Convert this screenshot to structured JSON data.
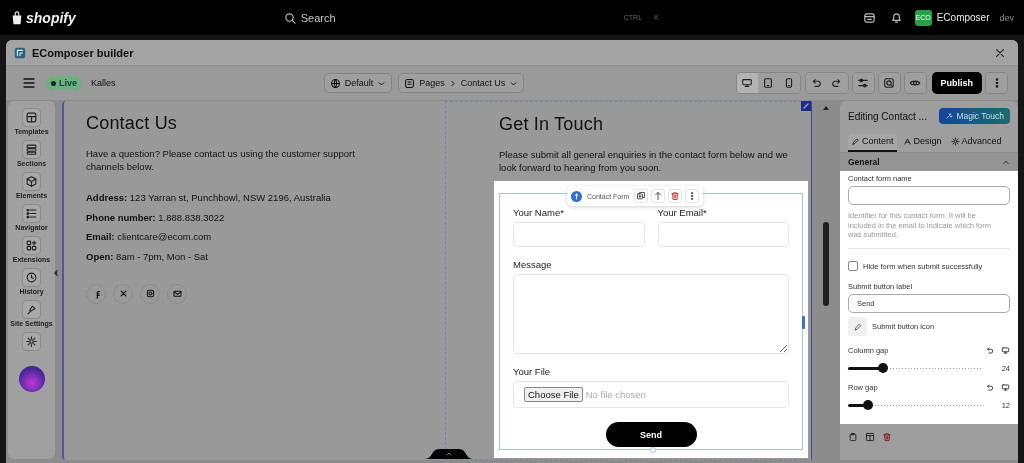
{
  "topbar": {
    "brand": "shopify",
    "search": {
      "placeholder": "Search"
    },
    "shortcut": [
      "CTRL",
      "K"
    ],
    "store": {
      "badge": "ECO",
      "name": "EComposer",
      "role": "dev"
    }
  },
  "window": {
    "title": "EComposer builder"
  },
  "toolbar": {
    "status": "Live",
    "store": "Kalles",
    "theme": "Default",
    "breadcrumb": [
      "Pages",
      "Contact Us"
    ],
    "devices": [
      {
        "kind": "desktop",
        "selected": true
      },
      {
        "kind": "tablet",
        "selected": false
      },
      {
        "kind": "mobile",
        "selected": false
      }
    ],
    "publish": "Publish"
  },
  "sidebar": {
    "items": [
      {
        "kind": "templates",
        "label": "Templates"
      },
      {
        "kind": "sections",
        "label": "Sections"
      },
      {
        "kind": "elements",
        "label": "Elements"
      },
      {
        "kind": "navigator",
        "label": "Navigator"
      },
      {
        "kind": "extensions",
        "label": "Extensions"
      },
      {
        "kind": "history",
        "label": "History"
      },
      {
        "kind": "site_settings",
        "label": "Site Settings"
      },
      {
        "kind": "settings"
      }
    ]
  },
  "page": {
    "left": {
      "heading": "Contact Us",
      "intro": "Have a question? Please contact us using the customer support channels below.",
      "details": [
        "**Address:** 123 Yarran st, Punchbowl, NSW 2196, Australia",
        "**Phone number:** 1.888.838.3022",
        "**Email:** clientcare@ecom.com",
        "**Open:** 8am - 7pm, Mon - Sat"
      ],
      "social": [
        {
          "kind": "facebook"
        },
        {
          "kind": "x"
        },
        {
          "kind": "instagram"
        },
        {
          "kind": "email"
        }
      ]
    },
    "right": {
      "heading": "Get In Touch",
      "intro": "Please submit all general enquiries in the contact form below and we look forward to hearing from you soon.",
      "form": {
        "toolbar_label": "Contact Form",
        "fields": [
          {
            "kind": "text",
            "label": "Your Name*"
          },
          {
            "kind": "text",
            "label": "Your Email*"
          },
          {
            "kind": "textarea",
            "label": "Message"
          },
          {
            "kind": "file",
            "label": "Your File",
            "button": "Choose File",
            "status": "No file chosen"
          }
        ],
        "submit": "Send"
      }
    }
  },
  "panel": {
    "title": "Editing Contact ...",
    "magic": "Magic Touch",
    "tabs": [
      {
        "label": "Content",
        "selected": true
      },
      {
        "label": "Design",
        "selected": false
      },
      {
        "label": "Advanced",
        "selected": false
      }
    ],
    "section": {
      "title": "General",
      "expanded": true
    },
    "settings": [
      {
        "kind": "text",
        "label": "Contact form name",
        "hint": "Identifier for this contact form. It will be included in the email to indicate which form was submitted."
      },
      {
        "kind": "checkbox",
        "label": "Hide form when submit successfully",
        "checked": false
      },
      {
        "kind": "text",
        "label": "Submit button label",
        "value": "Send"
      },
      {
        "kind": "icon",
        "label": "Submit button icon"
      },
      {
        "kind": "slider",
        "label": "Column gap",
        "level": 0.26,
        "reading": "24"
      },
      {
        "kind": "slider",
        "label": "Row gap",
        "level": 0.15,
        "reading": "12"
      }
    ]
  }
}
